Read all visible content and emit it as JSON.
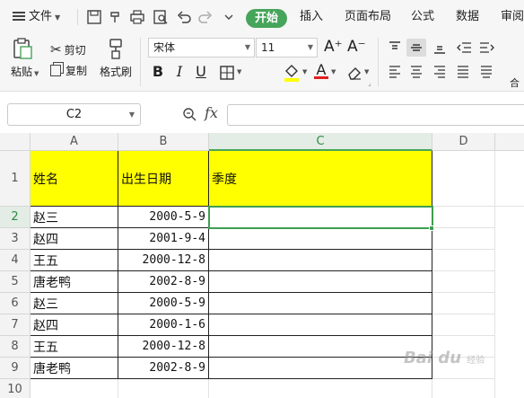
{
  "menubar": {
    "file_label": "文件",
    "tabs": [
      {
        "label": "开始",
        "active": true
      },
      {
        "label": "插入"
      },
      {
        "label": "页面布局"
      },
      {
        "label": "公式"
      },
      {
        "label": "数据"
      },
      {
        "label": "审阅"
      }
    ],
    "quick_icons": [
      "save-icon",
      "format-painter-quick-icon",
      "print-icon",
      "print-preview-icon",
      "undo-icon",
      "redo-icon",
      "more-icon"
    ]
  },
  "ribbon": {
    "paste_label": "粘贴",
    "cut_label": "剪切",
    "copy_label": "复制",
    "format_painter_label": "格式刷",
    "font_name": "宋体",
    "font_size": "11",
    "grow_font": "A⁺",
    "shrink_font": "A⁻",
    "bold": "B",
    "italic": "I",
    "underline": "U",
    "accent_color": "#46a55a",
    "highlight_color": "#ffff00",
    "font_color": "#e02020",
    "merge_label": "合"
  },
  "formula_bar": {
    "cell_ref": "C2",
    "fx_label": "fx",
    "formula_value": ""
  },
  "sheet": {
    "columns": [
      "A",
      "B",
      "C",
      "D"
    ],
    "selected_column": "C",
    "selected_cell": "C2",
    "header_row": {
      "name": "姓名",
      "birth": "出生日期",
      "season": "季度"
    },
    "rows": [
      {
        "row": "2",
        "name": "赵三",
        "birth": "2000-5-9",
        "season": ""
      },
      {
        "row": "3",
        "name": "赵四",
        "birth": "2001-9-4",
        "season": ""
      },
      {
        "row": "4",
        "name": "王五",
        "birth": "2000-12-8",
        "season": ""
      },
      {
        "row": "5",
        "name": "唐老鸭",
        "birth": "2002-8-9",
        "season": ""
      },
      {
        "row": "6",
        "name": "赵三",
        "birth": "2000-5-9",
        "season": ""
      },
      {
        "row": "7",
        "name": "赵四",
        "birth": "2000-1-6",
        "season": ""
      },
      {
        "row": "8",
        "name": "王五",
        "birth": "2000-12-8",
        "season": ""
      },
      {
        "row": "9",
        "name": "唐老鸭",
        "birth": "2002-8-9",
        "season": ""
      }
    ],
    "header_fill": "#ffff00",
    "selection_color": "#3f9e52"
  },
  "watermark": {
    "text": "Bai du",
    "sub": "经验"
  }
}
